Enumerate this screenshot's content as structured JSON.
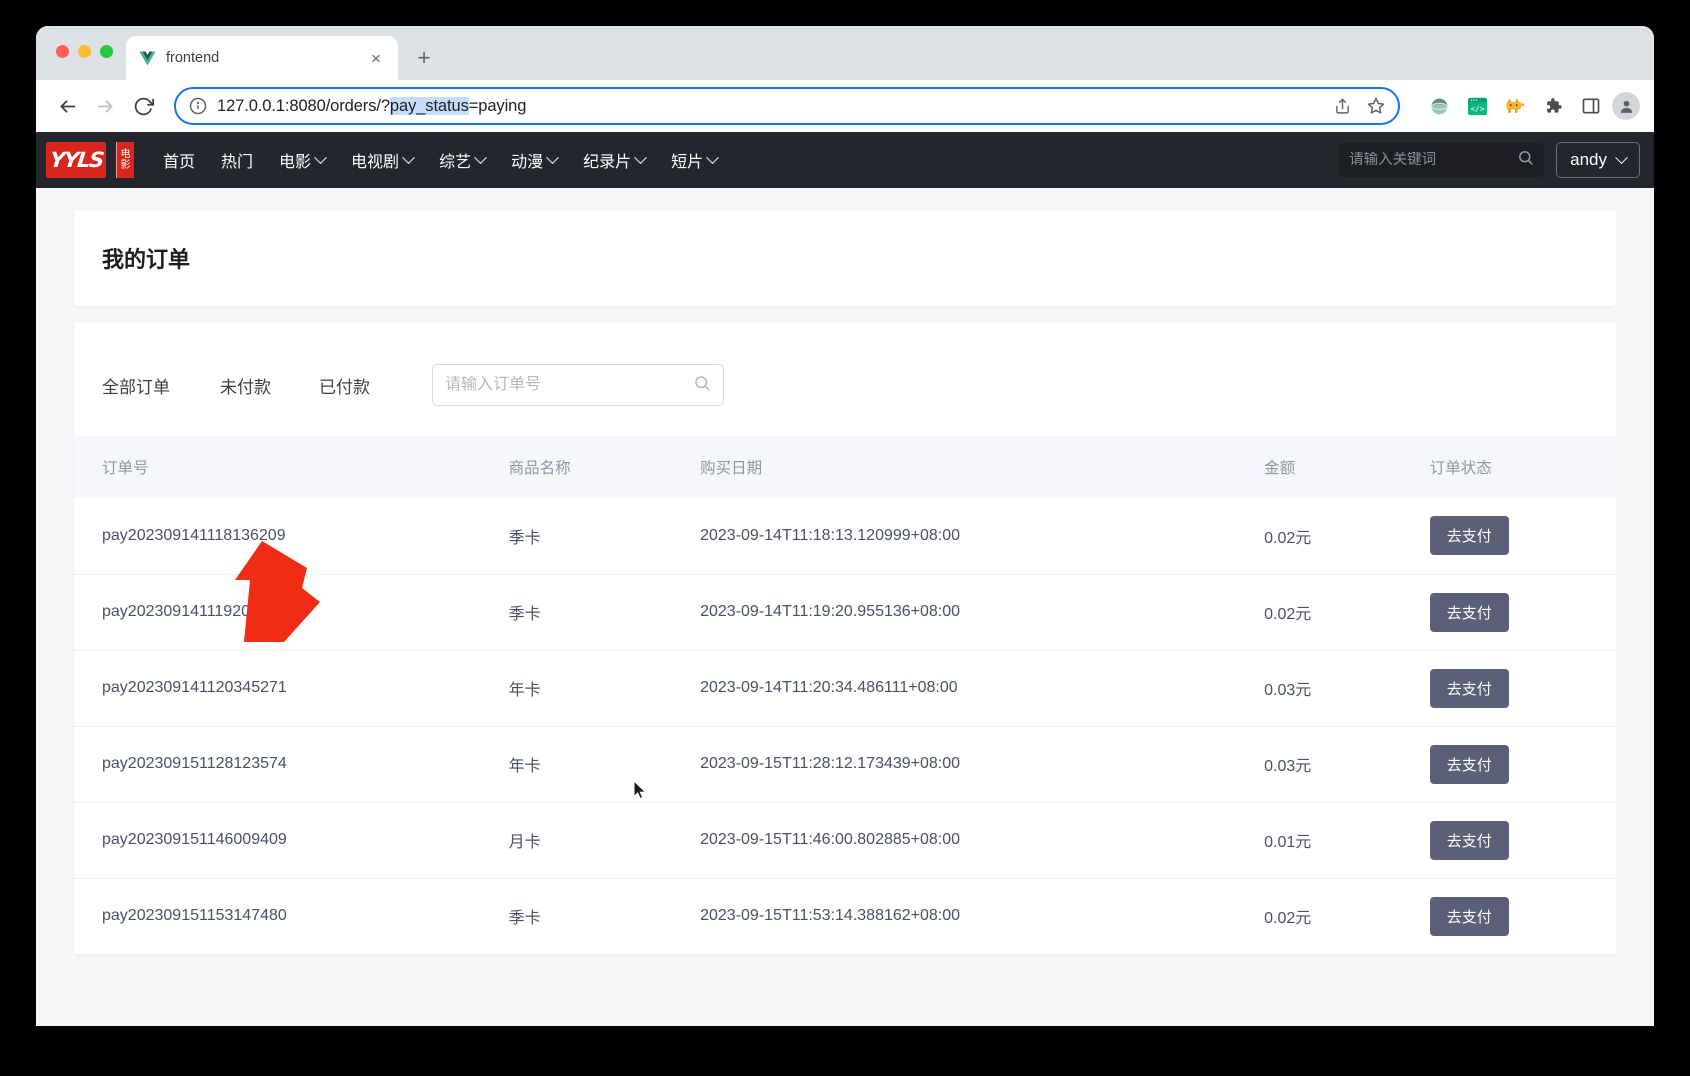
{
  "browser": {
    "tab": {
      "title": "frontend",
      "favicon": "vue-logo-icon",
      "close_label": "×"
    },
    "new_tab_label": "+",
    "url_prefix": "127.0.0.1:8080/orders/?",
    "url_highlight": "pay_status",
    "url_suffix": "=paying",
    "back_label": "←",
    "forward_label": "→",
    "reload_label": "↻"
  },
  "site_header": {
    "logo_text": "YYLS",
    "logo_cn_top": "电",
    "logo_cn_bottom": "影",
    "nav": [
      {
        "label": "首页",
        "has_caret": false
      },
      {
        "label": "热门",
        "has_caret": false
      },
      {
        "label": "电影",
        "has_caret": true
      },
      {
        "label": "电视剧",
        "has_caret": true
      },
      {
        "label": "综艺",
        "has_caret": true
      },
      {
        "label": "动漫",
        "has_caret": true
      },
      {
        "label": "纪录片",
        "has_caret": true
      },
      {
        "label": "短片",
        "has_caret": true
      }
    ],
    "search_placeholder": "请输入关键词",
    "search_value": "",
    "user_name": "andy"
  },
  "page": {
    "title": "我的订单",
    "filter_tabs": [
      {
        "label": "全部订单",
        "active": false
      },
      {
        "label": "未付款",
        "active": true
      },
      {
        "label": "已付款",
        "active": false
      }
    ],
    "order_search_placeholder": "请输入订单号",
    "order_search_value": ""
  },
  "table": {
    "headers": {
      "id": "订单号",
      "name": "商品名称",
      "date": "购买日期",
      "amount": "金额",
      "status": "订单状态"
    },
    "rows": [
      {
        "id": "pay202309141118136209",
        "name": "季卡",
        "date": "2023-09-14T11:18:13.120999+08:00",
        "amount": "0.02元",
        "action": "去支付"
      },
      {
        "id": "pay202309141119205368",
        "name": "季卡",
        "date": "2023-09-14T11:19:20.955136+08:00",
        "amount": "0.02元",
        "action": "去支付"
      },
      {
        "id": "pay202309141120345271",
        "name": "年卡",
        "date": "2023-09-14T11:20:34.486111+08:00",
        "amount": "0.03元",
        "action": "去支付"
      },
      {
        "id": "pay202309151128123574",
        "name": "年卡",
        "date": "2023-09-15T11:28:12.173439+08:00",
        "amount": "0.03元",
        "action": "去支付"
      },
      {
        "id": "pay202309151146009409",
        "name": "月卡",
        "date": "2023-09-15T11:46:00.802885+08:00",
        "amount": "0.01元",
        "action": "去支付"
      },
      {
        "id": "pay202309151153147480",
        "name": "季卡",
        "date": "2023-09-15T11:53:14.388162+08:00",
        "amount": "0.02元",
        "action": "去支付"
      }
    ]
  },
  "colors": {
    "brand_red": "#d9261c",
    "header_dark": "#24262d",
    "pay_button": "#5b6078",
    "annotation_red": "#f02d14",
    "url_highlight": "#c6dcfb",
    "omnibox_focus": "#1a73e8"
  }
}
